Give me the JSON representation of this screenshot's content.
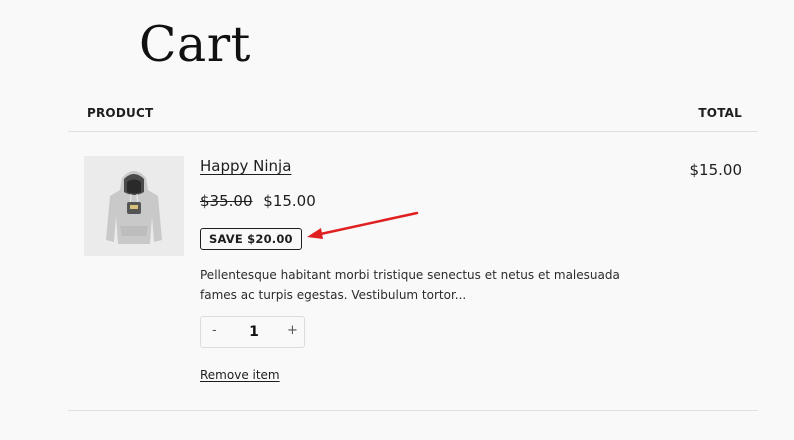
{
  "page": {
    "title": "Cart"
  },
  "table": {
    "product_header": "PRODUCT",
    "total_header": "TOTAL"
  },
  "item": {
    "image_icon": "hoodie-image",
    "name": "Happy Ninja",
    "regular_price": "$35.00",
    "sale_price": "$15.00",
    "save_badge": "SAVE $20.00",
    "description": "Pellentesque habitant morbi tristique senectus et netus et malesuada fames ac turpis egestas. Vestibulum tortor...",
    "quantity": "1",
    "minus_symbol": "-",
    "plus_symbol": "+",
    "remove_label": "Remove item",
    "line_total": "$15.00"
  },
  "annotation": {
    "arrow_color": "#e02020"
  }
}
